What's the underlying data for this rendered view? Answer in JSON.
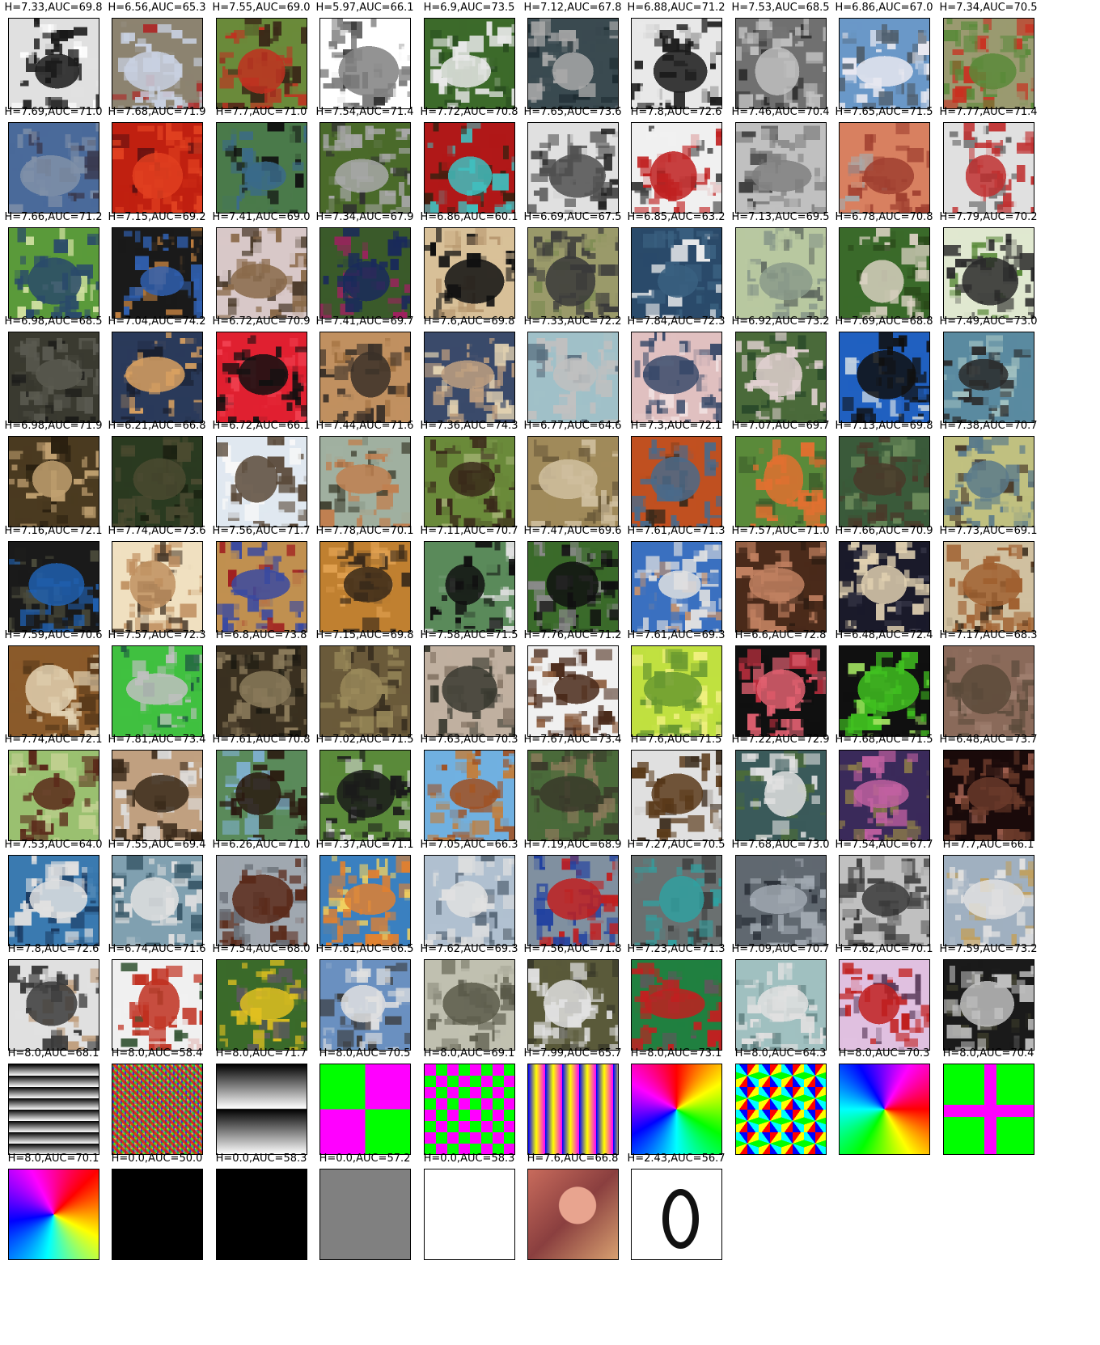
{
  "figure": {
    "cells": [
      {
        "label": "H=7.33,AUC=69.8",
        "img": "photo",
        "palette": [
          "#e0e0e0",
          "#1a1a1a",
          "#ffffff"
        ]
      },
      {
        "label": "H=6.56,AUC=65.3",
        "img": "photo",
        "palette": [
          "#8c8370",
          "#c8d0e0",
          "#b02020"
        ]
      },
      {
        "label": "H=7.55,AUC=69.0",
        "img": "photo",
        "palette": [
          "#6a8a3a",
          "#c03020",
          "#3a2a18"
        ]
      },
      {
        "label": "H=5.97,AUC=66.1",
        "img": "photo",
        "palette": [
          "#ffffff",
          "#808080",
          "#303030"
        ]
      },
      {
        "label": "H=6.9,AUC=73.5",
        "img": "photo",
        "palette": [
          "#3c6a2a",
          "#e8e8e8",
          "#2a5020"
        ]
      },
      {
        "label": "H=7.12,AUC=67.8",
        "img": "photo",
        "palette": [
          "#3a4a50",
          "#a8a8a8",
          "#1c2a30"
        ]
      },
      {
        "label": "H=6.88,AUC=71.2",
        "img": "photo",
        "palette": [
          "#e8e8e8",
          "#1a1a1a",
          "#b0b0b0"
        ]
      },
      {
        "label": "H=7.53,AUC=68.5",
        "img": "photo",
        "palette": [
          "#707070",
          "#c0c0c0",
          "#303030"
        ]
      },
      {
        "label": "H=6.86,AUC=67.0",
        "img": "photo",
        "palette": [
          "#6a98c8",
          "#e8e8f0",
          "#506070"
        ]
      },
      {
        "label": "H=7.34,AUC=70.5",
        "img": "photo",
        "palette": [
          "#9a9a70",
          "#5a8a3a",
          "#c83020"
        ]
      },
      {
        "label": "H=7.69,AUC=71.0",
        "img": "photo",
        "palette": [
          "#4a6a9a",
          "#8090a8",
          "#3a3a50"
        ]
      },
      {
        "label": "H=7.68,AUC=71.9",
        "img": "photo",
        "palette": [
          "#c02010",
          "#e04020",
          "#601010"
        ]
      },
      {
        "label": "H=7.7,AUC=71.0",
        "img": "photo",
        "palette": [
          "#4a7a4a",
          "#3a6a8a",
          "#101010"
        ]
      },
      {
        "label": "H=7.54,AUC=71.4",
        "img": "photo",
        "palette": [
          "#4a6a2a",
          "#a8a8a8",
          "#303030"
        ]
      },
      {
        "label": "H=7.72,AUC=70.8",
        "img": "photo",
        "palette": [
          "#b01818",
          "#40c0c0",
          "#402010"
        ]
      },
      {
        "label": "H=7.65,AUC=73.6",
        "img": "photo",
        "palette": [
          "#e0e0e0",
          "#505050",
          "#202020"
        ]
      },
      {
        "label": "H=7.8,AUC=72.6",
        "img": "photo",
        "palette": [
          "#f0f0f0",
          "#c02020",
          "#404040"
        ]
      },
      {
        "label": "H=7.46,AUC=70.4",
        "img": "photo",
        "palette": [
          "#c0c0c0",
          "#808080",
          "#404040"
        ]
      },
      {
        "label": "H=7.65,AUC=71.5",
        "img": "photo",
        "palette": [
          "#d88060",
          "#a04030",
          "#a8a8a8"
        ]
      },
      {
        "label": "H=7.77,AUC=71.4",
        "img": "photo",
        "palette": [
          "#e0e0e0",
          "#c03030",
          "#606060"
        ]
      },
      {
        "label": "H=7.66,AUC=71.2",
        "img": "photo",
        "palette": [
          "#5a9a3a",
          "#2a4a6a",
          "#d0e0a0"
        ]
      },
      {
        "label": "H=7.15,AUC=69.2",
        "img": "photo",
        "palette": [
          "#1a1a1a",
          "#3060b0",
          "#c08040"
        ]
      },
      {
        "label": "H=7.41,AUC=69.0",
        "img": "photo",
        "palette": [
          "#d8c8c8",
          "#8a6a4a",
          "#4a3a2a"
        ]
      },
      {
        "label": "H=7.34,AUC=67.9",
        "img": "photo",
        "palette": [
          "#3a5a2a",
          "#1a2a5a",
          "#a02060"
        ]
      },
      {
        "label": "H=6.86,AUC=60.1",
        "img": "photo",
        "palette": [
          "#d8c098",
          "#101010",
          "#b89870"
        ]
      },
      {
        "label": "H=6.69,AUC=67.5",
        "img": "photo",
        "palette": [
          "#9a9a6a",
          "#3a3a3a",
          "#7a8a50"
        ]
      },
      {
        "label": "H=6.85,AUC=63.2",
        "img": "photo",
        "palette": [
          "#2a4a6a",
          "#3a6080",
          "#f0f0f0"
        ]
      },
      {
        "label": "H=7.13,AUC=69.5",
        "img": "photo",
        "palette": [
          "#b8c8a0",
          "#8a9a8a",
          "#606a60"
        ]
      },
      {
        "label": "H=6.78,AUC=70.8",
        "img": "photo",
        "palette": [
          "#3a6a2a",
          "#d8d0c0",
          "#2a4a1a"
        ]
      },
      {
        "label": "H=7.79,AUC=70.2",
        "img": "photo",
        "palette": [
          "#e0e8d0",
          "#2a2a2a",
          "#5a8a3a"
        ]
      },
      {
        "label": "H=6.98,AUC=68.5",
        "img": "photo",
        "palette": [
          "#3a3a30",
          "#5a5a50",
          "#1a1a18"
        ]
      },
      {
        "label": "H=7.04,AUC=74.2",
        "img": "photo",
        "palette": [
          "#2a3a5a",
          "#d8a060",
          "#1a2030"
        ]
      },
      {
        "label": "H=6.72,AUC=70.9",
        "img": "photo",
        "palette": [
          "#e02030",
          "#101010",
          "#f04050"
        ]
      },
      {
        "label": "H=7.41,AUC=69.7",
        "img": "photo",
        "palette": [
          "#c09060",
          "#3a3028",
          "#a07040"
        ]
      },
      {
        "label": "H=7.6,AUC=69.8",
        "img": "photo",
        "palette": [
          "#3a4a6a",
          "#c0a080",
          "#e0d0b0"
        ]
      },
      {
        "label": "H=7.33,AUC=72.2",
        "img": "photo",
        "palette": [
          "#a0c0c8",
          "#c0c0c0",
          "#5a7080"
        ]
      },
      {
        "label": "H=7.84,AUC=72.3",
        "img": "photo",
        "palette": [
          "#e0c0c0",
          "#3a4a6a",
          "#f0e0e0"
        ]
      },
      {
        "label": "H=6.92,AUC=73.2",
        "img": "photo",
        "palette": [
          "#4a6a3a",
          "#e0d0d0",
          "#2a4a2a"
        ]
      },
      {
        "label": "H=7.69,AUC=68.8",
        "img": "photo",
        "palette": [
          "#2060c0",
          "#101010",
          "#c0d0e0"
        ]
      },
      {
        "label": "H=7.49,AUC=73.0",
        "img": "photo",
        "palette": [
          "#5a8aa0",
          "#2a2a2a",
          "#a0c0c0"
        ]
      },
      {
        "label": "H=6.98,AUC=71.9",
        "img": "photo",
        "palette": [
          "#4a3a20",
          "#c0a070",
          "#2a2010"
        ]
      },
      {
        "label": "H=6.21,AUC=66.8",
        "img": "photo",
        "palette": [
          "#2a3a20",
          "#4a4a30",
          "#1a2010"
        ]
      },
      {
        "label": "H=6.72,AUC=66.1",
        "img": "photo",
        "palette": [
          "#e0e8f0",
          "#5a4a3a",
          "#f8f8f8"
        ]
      },
      {
        "label": "H=7.44,AUC=71.6",
        "img": "photo",
        "palette": [
          "#a0b0a0",
          "#c08050",
          "#3a3a2a"
        ]
      },
      {
        "label": "H=7.36,AUC=74.3",
        "img": "photo",
        "palette": [
          "#6a8a3a",
          "#3a2a1a",
          "#a0b070"
        ]
      },
      {
        "label": "H=6.77,AUC=64.6",
        "img": "photo",
        "palette": [
          "#a08a5a",
          "#d0c0a0",
          "#6a5a3a"
        ]
      },
      {
        "label": "H=7.3,AUC=72.1",
        "img": "photo",
        "palette": [
          "#c05020",
          "#4a6a8a",
          "#3a2a1a"
        ]
      },
      {
        "label": "H=7.07,AUC=69.7",
        "img": "photo",
        "palette": [
          "#5a8a3a",
          "#e07030",
          "#3a5a2a"
        ]
      },
      {
        "label": "H=7.13,AUC=69.8",
        "img": "photo",
        "palette": [
          "#3a5a3a",
          "#4a3a2a",
          "#6a8a5a"
        ]
      },
      {
        "label": "H=7.38,AUC=70.7",
        "img": "photo",
        "palette": [
          "#c0c080",
          "#5a7a8a",
          "#4a3a2a"
        ]
      },
      {
        "label": "H=7.16,AUC=72.1",
        "img": "photo",
        "palette": [
          "#1a1a1a",
          "#2060b0",
          "#4a4a3a"
        ]
      },
      {
        "label": "H=7.74,AUC=73.6",
        "img": "photo",
        "palette": [
          "#f0e0c0",
          "#c09060",
          "#4a3a2a"
        ]
      },
      {
        "label": "H=7.56,AUC=71.7",
        "img": "photo",
        "palette": [
          "#c09050",
          "#3a4aa0",
          "#a02020"
        ]
      },
      {
        "label": "H=7.78,AUC=70.1",
        "img": "photo",
        "palette": [
          "#c08030",
          "#3a2a1a",
          "#e0a050"
        ]
      },
      {
        "label": "H=7.11,AUC=70.7",
        "img": "photo",
        "palette": [
          "#5a8a5a",
          "#101010",
          "#e0e0e0"
        ]
      },
      {
        "label": "H=7.47,AUC=69.6",
        "img": "photo",
        "palette": [
          "#3a6a2a",
          "#101010",
          "#8a8a8a"
        ]
      },
      {
        "label": "H=7.61,AUC=71.3",
        "img": "photo",
        "palette": [
          "#3a70c0",
          "#e0e0e0",
          "#c09070"
        ]
      },
      {
        "label": "H=7.57,AUC=71.0",
        "img": "photo",
        "palette": [
          "#4a2a1a",
          "#c08060",
          "#2a1a10"
        ]
      },
      {
        "label": "H=7.66,AUC=70.9",
        "img": "photo",
        "palette": [
          "#1a1a2a",
          "#e0d0b0",
          "#3a3a4a"
        ]
      },
      {
        "label": "H=7.73,AUC=69.1",
        "img": "photo",
        "palette": [
          "#d0c0a0",
          "#a06030",
          "#3a2a1a"
        ]
      },
      {
        "label": "H=7.59,AUC=70.6",
        "img": "photo",
        "palette": [
          "#8a5a2a",
          "#e0d0b0",
          "#5a3a1a"
        ]
      },
      {
        "label": "H=7.57,AUC=72.3",
        "img": "photo",
        "palette": [
          "#40c040",
          "#c0c0c0",
          "#206040"
        ]
      },
      {
        "label": "H=6.8,AUC=73.8",
        "img": "photo",
        "palette": [
          "#3a3020",
          "#8a7a5a",
          "#1a1810"
        ]
      },
      {
        "label": "H=7.15,AUC=69.8",
        "img": "photo",
        "palette": [
          "#6a5a3a",
          "#9a8a5a",
          "#3a3020"
        ]
      },
      {
        "label": "H=7.58,AUC=71.5",
        "img": "photo",
        "palette": [
          "#c0b0a0",
          "#3a3a30",
          "#8a7a6a"
        ]
      },
      {
        "label": "H=7.76,AUC=71.2",
        "img": "photo",
        "palette": [
          "#f0f0f0",
          "#4a2a1a",
          "#8a5a3a"
        ]
      },
      {
        "label": "H=7.61,AUC=69.3",
        "img": "photo",
        "palette": [
          "#c0e040",
          "#6a9a30",
          "#f0f080"
        ]
      },
      {
        "label": "H=6.6,AUC=72.8",
        "img": "photo",
        "palette": [
          "#101010",
          "#e06070",
          "#c03040"
        ]
      },
      {
        "label": "H=6.48,AUC=72.4",
        "img": "photo",
        "palette": [
          "#101010",
          "#40c020",
          "#a0e060"
        ]
      },
      {
        "label": "H=7.17,AUC=68.3",
        "img": "photo",
        "palette": [
          "#8a6a5a",
          "#5a4a3a",
          "#a08070"
        ]
      },
      {
        "label": "H=7.74,AUC=72.1",
        "img": "photo",
        "palette": [
          "#9ac070",
          "#5a2a1a",
          "#c0d090"
        ]
      },
      {
        "label": "H=7.81,AUC=73.4",
        "img": "photo",
        "palette": [
          "#c0a080",
          "#3a2a1a",
          "#e0e0e0"
        ]
      },
      {
        "label": "H=7.61,AUC=70.8",
        "img": "photo",
        "palette": [
          "#5a8a5a",
          "#2a1a10",
          "#80b0d0"
        ]
      },
      {
        "label": "H=7.02,AUC=71.5",
        "img": "photo",
        "palette": [
          "#5a8a3a",
          "#1a1a1a",
          "#e0e0e0"
        ]
      },
      {
        "label": "H=7.63,AUC=70.3",
        "img": "photo",
        "palette": [
          "#70b0e0",
          "#a05020",
          "#c08040"
        ]
      },
      {
        "label": "H=7.67,AUC=73.4",
        "img": "photo",
        "palette": [
          "#4a6a3a",
          "#3a3a2a",
          "#8a7a5a"
        ]
      },
      {
        "label": "H=7.6,AUC=71.5",
        "img": "photo",
        "palette": [
          "#e0e0e0",
          "#5a3a1a",
          "#3a2a1a"
        ]
      },
      {
        "label": "H=7.22,AUC=72.9",
        "img": "photo",
        "palette": [
          "#3a5a5a",
          "#e0e0e0",
          "#4a6a3a"
        ]
      },
      {
        "label": "H=7.68,AUC=71.5",
        "img": "photo",
        "palette": [
          "#3a2a5a",
          "#c060a0",
          "#8a7a4a"
        ]
      },
      {
        "label": "H=6.48,AUC=73.7",
        "img": "photo",
        "palette": [
          "#1a0a0a",
          "#6a3a2a",
          "#a06050"
        ]
      },
      {
        "label": "H=7.53,AUC=64.0",
        "img": "photo",
        "palette": [
          "#3a7ab0",
          "#e0e0e0",
          "#1a3a60"
        ]
      },
      {
        "label": "H=7.55,AUC=69.4",
        "img": "photo",
        "palette": [
          "#80a0b0",
          "#e0e0e0",
          "#3a5a6a"
        ]
      },
      {
        "label": "H=6.26,AUC=71.0",
        "img": "photo",
        "palette": [
          "#a0a8b0",
          "#5a2a1a",
          "#6a7078"
        ]
      },
      {
        "label": "H=7.37,AUC=71.1",
        "img": "photo",
        "palette": [
          "#3a80c0",
          "#e08030",
          "#f0d060"
        ]
      },
      {
        "label": "H=7.05,AUC=66.3",
        "img": "photo",
        "palette": [
          "#b0c0d0",
          "#e0e0e0",
          "#5a6a7a"
        ]
      },
      {
        "label": "H=7.19,AUC=68.9",
        "img": "photo",
        "palette": [
          "#8090a0",
          "#c02020",
          "#2040a0"
        ]
      },
      {
        "label": "H=7.27,AUC=70.5",
        "img": "photo",
        "palette": [
          "#6a7070",
          "#30a0a0",
          "#3a3a3a"
        ]
      },
      {
        "label": "H=7.68,AUC=73.0",
        "img": "photo",
        "palette": [
          "#606870",
          "#a0a8b0",
          "#2a3038"
        ]
      },
      {
        "label": "H=7.54,AUC=67.7",
        "img": "photo",
        "palette": [
          "#c0c0c0",
          "#3a3a3a",
          "#808080"
        ]
      },
      {
        "label": "H=7.7,AUC=66.1",
        "img": "photo",
        "palette": [
          "#a0b0c0",
          "#e0e0e0",
          "#c0a060"
        ]
      },
      {
        "label": "H=7.8,AUC=72.6",
        "img": "photo",
        "palette": [
          "#e0e0e0",
          "#3a3a3a",
          "#c0a080"
        ]
      },
      {
        "label": "H=6.74,AUC=71.6",
        "img": "photo",
        "palette": [
          "#f0f0f0",
          "#c03020",
          "#3a5a3a"
        ]
      },
      {
        "label": "H=7.54,AUC=68.0",
        "img": "photo",
        "palette": [
          "#3a6a2a",
          "#e0c020",
          "#5a5a5a"
        ]
      },
      {
        "label": "H=7.61,AUC=66.5",
        "img": "photo",
        "palette": [
          "#6a90c0",
          "#e0e0e0",
          "#3a3a3a"
        ]
      },
      {
        "label": "H=7.62,AUC=69.3",
        "img": "photo",
        "palette": [
          "#c0c0b0",
          "#5a5a4a",
          "#8a8a7a"
        ]
      },
      {
        "label": "H=7.56,AUC=71.8",
        "img": "photo",
        "palette": [
          "#5a5a3a",
          "#e0e0e0",
          "#3a3a2a"
        ]
      },
      {
        "label": "H=7.23,AUC=71.3",
        "img": "photo",
        "palette": [
          "#208040",
          "#c02020",
          "#5a5a5a"
        ]
      },
      {
        "label": "H=7.09,AUC=70.7",
        "img": "photo",
        "palette": [
          "#a0c0c0",
          "#e0e0e0",
          "#5a7a7a"
        ]
      },
      {
        "label": "H=7.62,AUC=70.1",
        "img": "photo",
        "palette": [
          "#e0c0e0",
          "#c02020",
          "#5a3a5a"
        ]
      },
      {
        "label": "H=7.59,AUC=73.2",
        "img": "photo",
        "palette": [
          "#1a1a1a",
          "#c0c0c0",
          "#3a3a2a"
        ]
      },
      {
        "label": "H=8.0,AUC=68.1",
        "img": "p-hstripes"
      },
      {
        "label": "H=8.0,AUC=58.4",
        "img": "p-noise"
      },
      {
        "label": "H=8.0,AUC=71.7",
        "img": "p-grad-quads"
      },
      {
        "label": "H=8.0,AUC=70.5",
        "img": "p-magenta-green"
      },
      {
        "label": "H=8.0,AUC=69.1",
        "img": "p-rgb-tiles"
      },
      {
        "label": "H=7.99,AUC=65.7",
        "img": "p-bars-v"
      },
      {
        "label": "H=8.0,AUC=73.1",
        "img": "p-rainbow-quads"
      },
      {
        "label": "H=8.0,AUC=64.3",
        "img": "p-rainbow-tiles"
      },
      {
        "label": "H=8.0,AUC=70.3",
        "img": "p-rainbow-quads2"
      },
      {
        "label": "H=8.0,AUC=70.4",
        "img": "p-magenta-cross"
      },
      {
        "label": "H=8.0,AUC=70.1",
        "img": "p-cool-quads"
      },
      {
        "label": "H=0.0,AUC=50.0",
        "img": "p-black"
      },
      {
        "label": "H=0.0,AUC=58.3",
        "img": "p-black"
      },
      {
        "label": "H=0.0,AUC=57.2",
        "img": "p-gray"
      },
      {
        "label": "H=0.0,AUC=58.3",
        "img": "p-white"
      },
      {
        "label": "H=7.6,AUC=66.8",
        "img": "p-lena"
      },
      {
        "label": "H=2.43,AUC=56.7",
        "img": "p-zero"
      }
    ]
  }
}
